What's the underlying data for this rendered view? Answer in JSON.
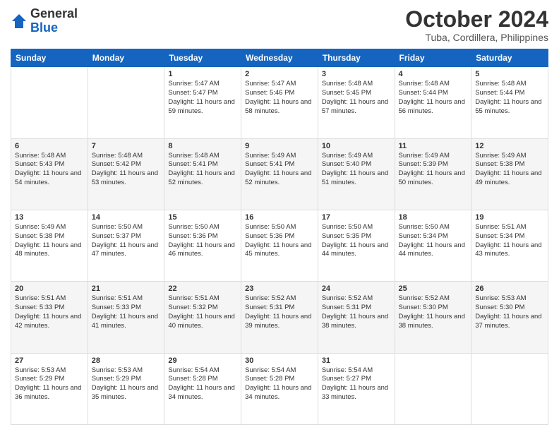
{
  "logo": {
    "general": "General",
    "blue": "Blue"
  },
  "header": {
    "month": "October 2024",
    "location": "Tuba, Cordillera, Philippines"
  },
  "days_of_week": [
    "Sunday",
    "Monday",
    "Tuesday",
    "Wednesday",
    "Thursday",
    "Friday",
    "Saturday"
  ],
  "weeks": [
    [
      {
        "day": "",
        "sunrise": "",
        "sunset": "",
        "daylight": ""
      },
      {
        "day": "",
        "sunrise": "",
        "sunset": "",
        "daylight": ""
      },
      {
        "day": "1",
        "sunrise": "Sunrise: 5:47 AM",
        "sunset": "Sunset: 5:47 PM",
        "daylight": "Daylight: 11 hours and 59 minutes."
      },
      {
        "day": "2",
        "sunrise": "Sunrise: 5:47 AM",
        "sunset": "Sunset: 5:46 PM",
        "daylight": "Daylight: 11 hours and 58 minutes."
      },
      {
        "day": "3",
        "sunrise": "Sunrise: 5:48 AM",
        "sunset": "Sunset: 5:45 PM",
        "daylight": "Daylight: 11 hours and 57 minutes."
      },
      {
        "day": "4",
        "sunrise": "Sunrise: 5:48 AM",
        "sunset": "Sunset: 5:44 PM",
        "daylight": "Daylight: 11 hours and 56 minutes."
      },
      {
        "day": "5",
        "sunrise": "Sunrise: 5:48 AM",
        "sunset": "Sunset: 5:44 PM",
        "daylight": "Daylight: 11 hours and 55 minutes."
      }
    ],
    [
      {
        "day": "6",
        "sunrise": "Sunrise: 5:48 AM",
        "sunset": "Sunset: 5:43 PM",
        "daylight": "Daylight: 11 hours and 54 minutes."
      },
      {
        "day": "7",
        "sunrise": "Sunrise: 5:48 AM",
        "sunset": "Sunset: 5:42 PM",
        "daylight": "Daylight: 11 hours and 53 minutes."
      },
      {
        "day": "8",
        "sunrise": "Sunrise: 5:48 AM",
        "sunset": "Sunset: 5:41 PM",
        "daylight": "Daylight: 11 hours and 52 minutes."
      },
      {
        "day": "9",
        "sunrise": "Sunrise: 5:49 AM",
        "sunset": "Sunset: 5:41 PM",
        "daylight": "Daylight: 11 hours and 52 minutes."
      },
      {
        "day": "10",
        "sunrise": "Sunrise: 5:49 AM",
        "sunset": "Sunset: 5:40 PM",
        "daylight": "Daylight: 11 hours and 51 minutes."
      },
      {
        "day": "11",
        "sunrise": "Sunrise: 5:49 AM",
        "sunset": "Sunset: 5:39 PM",
        "daylight": "Daylight: 11 hours and 50 minutes."
      },
      {
        "day": "12",
        "sunrise": "Sunrise: 5:49 AM",
        "sunset": "Sunset: 5:38 PM",
        "daylight": "Daylight: 11 hours and 49 minutes."
      }
    ],
    [
      {
        "day": "13",
        "sunrise": "Sunrise: 5:49 AM",
        "sunset": "Sunset: 5:38 PM",
        "daylight": "Daylight: 11 hours and 48 minutes."
      },
      {
        "day": "14",
        "sunrise": "Sunrise: 5:50 AM",
        "sunset": "Sunset: 5:37 PM",
        "daylight": "Daylight: 11 hours and 47 minutes."
      },
      {
        "day": "15",
        "sunrise": "Sunrise: 5:50 AM",
        "sunset": "Sunset: 5:36 PM",
        "daylight": "Daylight: 11 hours and 46 minutes."
      },
      {
        "day": "16",
        "sunrise": "Sunrise: 5:50 AM",
        "sunset": "Sunset: 5:36 PM",
        "daylight": "Daylight: 11 hours and 45 minutes."
      },
      {
        "day": "17",
        "sunrise": "Sunrise: 5:50 AM",
        "sunset": "Sunset: 5:35 PM",
        "daylight": "Daylight: 11 hours and 44 minutes."
      },
      {
        "day": "18",
        "sunrise": "Sunrise: 5:50 AM",
        "sunset": "Sunset: 5:34 PM",
        "daylight": "Daylight: 11 hours and 44 minutes."
      },
      {
        "day": "19",
        "sunrise": "Sunrise: 5:51 AM",
        "sunset": "Sunset: 5:34 PM",
        "daylight": "Daylight: 11 hours and 43 minutes."
      }
    ],
    [
      {
        "day": "20",
        "sunrise": "Sunrise: 5:51 AM",
        "sunset": "Sunset: 5:33 PM",
        "daylight": "Daylight: 11 hours and 42 minutes."
      },
      {
        "day": "21",
        "sunrise": "Sunrise: 5:51 AM",
        "sunset": "Sunset: 5:33 PM",
        "daylight": "Daylight: 11 hours and 41 minutes."
      },
      {
        "day": "22",
        "sunrise": "Sunrise: 5:51 AM",
        "sunset": "Sunset: 5:32 PM",
        "daylight": "Daylight: 11 hours and 40 minutes."
      },
      {
        "day": "23",
        "sunrise": "Sunrise: 5:52 AM",
        "sunset": "Sunset: 5:31 PM",
        "daylight": "Daylight: 11 hours and 39 minutes."
      },
      {
        "day": "24",
        "sunrise": "Sunrise: 5:52 AM",
        "sunset": "Sunset: 5:31 PM",
        "daylight": "Daylight: 11 hours and 38 minutes."
      },
      {
        "day": "25",
        "sunrise": "Sunrise: 5:52 AM",
        "sunset": "Sunset: 5:30 PM",
        "daylight": "Daylight: 11 hours and 38 minutes."
      },
      {
        "day": "26",
        "sunrise": "Sunrise: 5:53 AM",
        "sunset": "Sunset: 5:30 PM",
        "daylight": "Daylight: 11 hours and 37 minutes."
      }
    ],
    [
      {
        "day": "27",
        "sunrise": "Sunrise: 5:53 AM",
        "sunset": "Sunset: 5:29 PM",
        "daylight": "Daylight: 11 hours and 36 minutes."
      },
      {
        "day": "28",
        "sunrise": "Sunrise: 5:53 AM",
        "sunset": "Sunset: 5:29 PM",
        "daylight": "Daylight: 11 hours and 35 minutes."
      },
      {
        "day": "29",
        "sunrise": "Sunrise: 5:54 AM",
        "sunset": "Sunset: 5:28 PM",
        "daylight": "Daylight: 11 hours and 34 minutes."
      },
      {
        "day": "30",
        "sunrise": "Sunrise: 5:54 AM",
        "sunset": "Sunset: 5:28 PM",
        "daylight": "Daylight: 11 hours and 34 minutes."
      },
      {
        "day": "31",
        "sunrise": "Sunrise: 5:54 AM",
        "sunset": "Sunset: 5:27 PM",
        "daylight": "Daylight: 11 hours and 33 minutes."
      },
      {
        "day": "",
        "sunrise": "",
        "sunset": "",
        "daylight": ""
      },
      {
        "day": "",
        "sunrise": "",
        "sunset": "",
        "daylight": ""
      }
    ]
  ]
}
